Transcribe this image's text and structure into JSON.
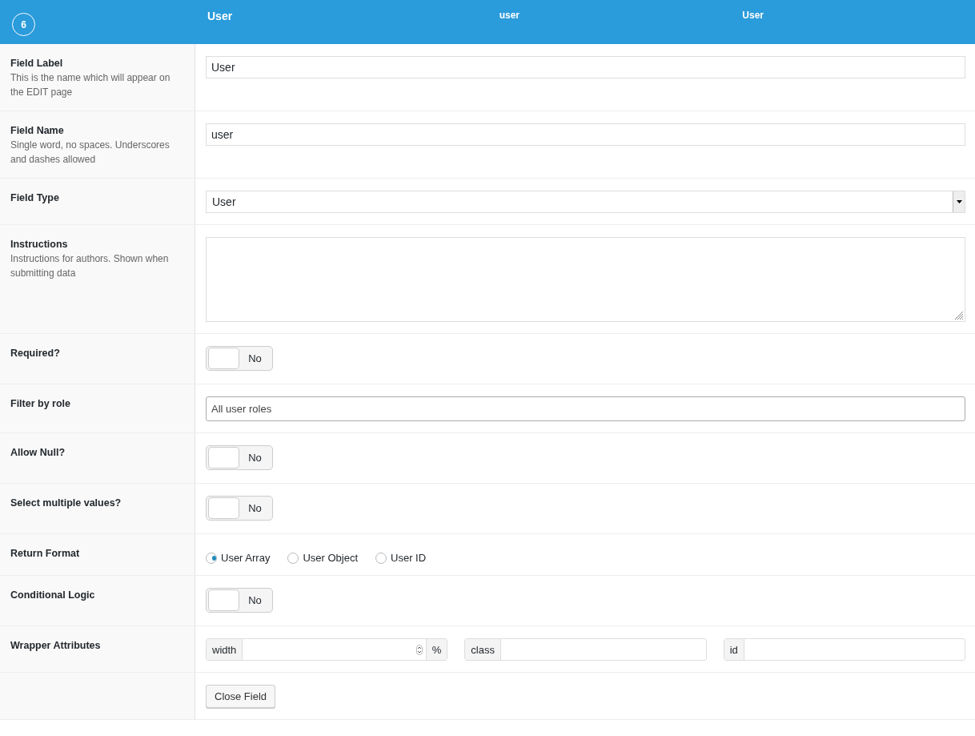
{
  "header": {
    "order": "6",
    "label": "User",
    "name": "user",
    "type": "User"
  },
  "rows": [
    {
      "kind": "text",
      "label": "Field Label",
      "description": "This is the name which will appear on the EDIT page",
      "value": "User"
    },
    {
      "kind": "text",
      "label": "Field Name",
      "description": "Single word, no spaces. Underscores and dashes allowed",
      "value": "user"
    },
    {
      "kind": "select",
      "label": "Field Type",
      "value": "User"
    },
    {
      "kind": "textarea",
      "label": "Instructions",
      "description": "Instructions for authors. Shown when submitting data"
    },
    {
      "kind": "toggle",
      "label": "Required?",
      "on": false,
      "text": "No"
    },
    {
      "kind": "multiselect",
      "label": "Filter by role",
      "placeholder": "All user roles"
    },
    {
      "kind": "toggle",
      "label": "Allow Null?",
      "on": false,
      "text": "No"
    },
    {
      "kind": "toggle",
      "label": "Select multiple values?",
      "on": false,
      "text": "No"
    },
    {
      "kind": "radio",
      "label": "Return Format",
      "options": [
        {
          "label": "User Array",
          "selected": true
        },
        {
          "label": "User Object",
          "selected": false
        },
        {
          "label": "User ID",
          "selected": false
        }
      ]
    },
    {
      "kind": "toggle",
      "label": "Conditional Logic",
      "on": false,
      "text": "No"
    },
    {
      "kind": "wrapper",
      "label": "Wrapper Attributes",
      "fields": [
        {
          "prepend": "width",
          "append": "%",
          "spinner": true
        },
        {
          "prepend": "class"
        },
        {
          "prepend": "id"
        }
      ]
    },
    {
      "kind": "button",
      "button": "Close Field"
    }
  ]
}
